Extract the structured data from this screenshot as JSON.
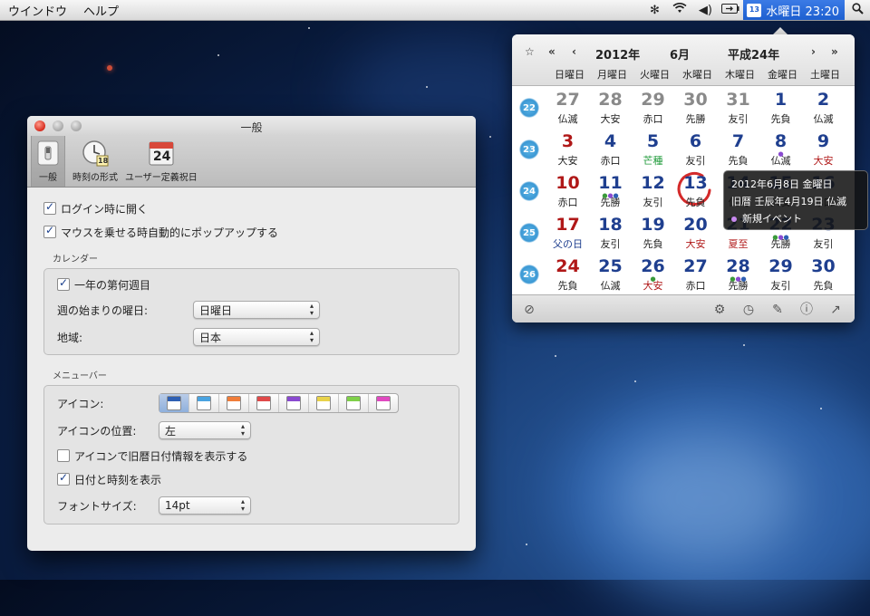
{
  "menubar": {
    "items": [
      "ウインドウ",
      "ヘルプ"
    ],
    "clock_text": "水曜日 23:20",
    "clock_icon_day": "13",
    "right_icons": [
      "bluetooth-icon",
      "wifi-icon",
      "volume-icon",
      "battery-icon",
      "spotlight-icon"
    ]
  },
  "prefs": {
    "title": "一般",
    "toolbar": [
      {
        "label": "一般",
        "icon": "switch-icon",
        "selected": true
      },
      {
        "label": "時刻の形式",
        "icon": "clock-icon",
        "badge": "18"
      },
      {
        "label": "ユーザー定義祝日",
        "icon": "calendar-icon",
        "badge": "24"
      }
    ],
    "login_open": "ログイン時に開く",
    "popup_on_hover": "マウスを乗せる時自動的にポップアップする",
    "calendar_section": "カレンダー",
    "week_number": "一年の第何週目",
    "week_start_label": "週の始まりの曜日:",
    "week_start_value": "日曜日",
    "region_label": "地域:",
    "region_value": "日本",
    "menubar_section": "メニューバー",
    "icon_label": "アイコン:",
    "icon_colors": [
      "#2e5fb3",
      "#4aa3e0",
      "#f07d3a",
      "#e04a4a",
      "#8a4ad0",
      "#e8d24a",
      "#7fd04a",
      "#e04ac0"
    ],
    "icon_position_label": "アイコンの位置:",
    "icon_position_value": "左",
    "show_lunar_icon": "アイコンで旧暦日付情報を表示する",
    "show_datetime": "日付と時刻を表示",
    "font_size_label": "フォントサイズ:",
    "font_size_value": "14pt"
  },
  "calendar": {
    "nav_first": "«",
    "nav_prev": "‹",
    "year": "2012年",
    "month": "6月",
    "era_year": "平成24年",
    "nav_next": "›",
    "nav_last": "»",
    "weekdays": [
      "日曜日",
      "月曜日",
      "火曜日",
      "水曜日",
      "木曜日",
      "金曜日",
      "土曜日"
    ],
    "weeks": [
      {
        "wk": "22",
        "days": [
          {
            "n": "27",
            "s": "仏滅",
            "c": "gray"
          },
          {
            "n": "28",
            "s": "大安",
            "c": "gray"
          },
          {
            "n": "29",
            "s": "赤口",
            "c": "gray"
          },
          {
            "n": "30",
            "s": "先勝",
            "c": "gray"
          },
          {
            "n": "31",
            "s": "友引",
            "c": "gray"
          },
          {
            "n": "1",
            "s": "先負",
            "c": "blue"
          },
          {
            "n": "2",
            "s": "仏滅",
            "c": "blue"
          }
        ]
      },
      {
        "wk": "23",
        "days": [
          {
            "n": "3",
            "s": "大安",
            "c": "red"
          },
          {
            "n": "4",
            "s": "赤口",
            "c": "blue"
          },
          {
            "n": "5",
            "s": "芒種",
            "c": "blue",
            "sc": "green"
          },
          {
            "n": "6",
            "s": "友引",
            "c": "blue"
          },
          {
            "n": "7",
            "s": "先負",
            "c": "blue"
          },
          {
            "n": "8",
            "s": "仏滅",
            "c": "blue",
            "dots": "purple"
          },
          {
            "n": "9",
            "s": "大安",
            "c": "blue",
            "sc": "red"
          }
        ]
      },
      {
        "wk": "24",
        "days": [
          {
            "n": "10",
            "s": "赤口",
            "c": "red"
          },
          {
            "n": "11",
            "s": "先勝",
            "c": "blue",
            "dots": "multi"
          },
          {
            "n": "12",
            "s": "友引",
            "c": "blue"
          },
          {
            "n": "13",
            "s": "先負",
            "c": "blue",
            "today": true
          },
          {
            "n": "14",
            "s": "仏滅",
            "c": "blue"
          },
          {
            "n": "15",
            "s": "大安",
            "c": "blue"
          },
          {
            "n": "16",
            "s": "赤口",
            "c": "blue"
          }
        ]
      },
      {
        "wk": "25",
        "days": [
          {
            "n": "17",
            "s": "父の日",
            "c": "red",
            "sc": "blue"
          },
          {
            "n": "18",
            "s": "友引",
            "c": "blue"
          },
          {
            "n": "19",
            "s": "先負",
            "c": "blue"
          },
          {
            "n": "20",
            "s": "大安",
            "c": "blue",
            "sc": "red"
          },
          {
            "n": "21",
            "s": "夏至",
            "c": "blue",
            "sc": "red"
          },
          {
            "n": "22",
            "s": "先勝",
            "c": "blue",
            "dots": "multi"
          },
          {
            "n": "23",
            "s": "友引",
            "c": "blue"
          }
        ]
      },
      {
        "wk": "26",
        "days": [
          {
            "n": "24",
            "s": "先負",
            "c": "red"
          },
          {
            "n": "25",
            "s": "仏滅",
            "c": "blue"
          },
          {
            "n": "26",
            "s": "大安",
            "c": "blue",
            "sc": "red",
            "dots": "green"
          },
          {
            "n": "27",
            "s": "赤口",
            "c": "blue"
          },
          {
            "n": "28",
            "s": "先勝",
            "c": "blue",
            "dots": "multi"
          },
          {
            "n": "29",
            "s": "友引",
            "c": "blue"
          },
          {
            "n": "30",
            "s": "先負",
            "c": "blue"
          }
        ]
      }
    ]
  },
  "tooltip": {
    "line1": "2012年6月8日 金曜日",
    "line2": "旧暦 壬辰年4月19日 仏滅",
    "event": "新規イベント"
  },
  "colors": {
    "blue": "#1f3f8f",
    "red": "#b01818",
    "gray": "#8a8a8a",
    "green": "#1f9a3a"
  }
}
